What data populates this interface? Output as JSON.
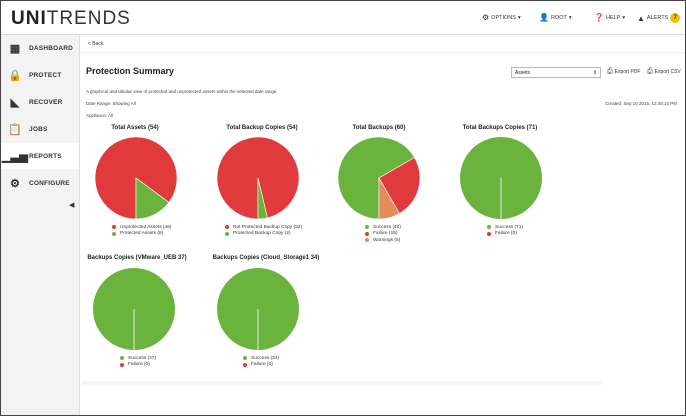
{
  "app": {
    "logo_bold": "UNI",
    "logo_rest": "TRENDS"
  },
  "topmenu": {
    "options": "OPTIONS",
    "root": "ROOT",
    "help": "HELP",
    "alerts": "ALERTS",
    "alerts_count": "7"
  },
  "sidebar": {
    "items": [
      {
        "label": "DASHBOARD",
        "icon": "grid-icon"
      },
      {
        "label": "PROTECT",
        "icon": "lock-icon"
      },
      {
        "label": "RECOVER",
        "icon": "recover-icon"
      },
      {
        "label": "JOBS",
        "icon": "clipboard-icon"
      },
      {
        "label": "REPORTS",
        "icon": "bar-chart-icon"
      },
      {
        "label": "CONFIGURE",
        "icon": "gear-icon"
      }
    ],
    "active": "REPORTS"
  },
  "page": {
    "back": "< Back",
    "title": "Protection Summary",
    "description": "A graphical and tabular view of protected and unprotected assets within the selected date range.",
    "date_range": "Date Range: Showing All",
    "appliance": "Appliance: All",
    "created": "Created: Sep 10 2015, 12:48:10 PM",
    "select_value": "Assets",
    "export_pdf": "Export PDF",
    "export_csv": "Export CSV"
  },
  "colors": {
    "red": "#e03a3c",
    "green": "#6ab43e",
    "orange": "#e58a5a"
  },
  "chart_data": [
    {
      "type": "pie",
      "title": "Total Assets (54)",
      "slices": [
        {
          "label": "Unprotected Assets (46)",
          "value": 46,
          "color": "#e03a3c"
        },
        {
          "label": "Protected Assets (8)",
          "value": 8,
          "color": "#6ab43e"
        }
      ]
    },
    {
      "type": "pie",
      "title": "Total Backup Copies (54)",
      "slices": [
        {
          "label": "Not Protected Backup Copy (52)",
          "value": 52,
          "color": "#e03a3c"
        },
        {
          "label": "Protected Backup Copy (2)",
          "value": 2,
          "color": "#6ab43e"
        }
      ]
    },
    {
      "type": "pie",
      "title": "Total Backups (60)",
      "slices": [
        {
          "label": "Success (40)",
          "value": 40,
          "color": "#6ab43e"
        },
        {
          "label": "Failure (15)",
          "value": 15,
          "color": "#e03a3c"
        },
        {
          "label": "Warnings (5)",
          "value": 5,
          "color": "#e58a5a"
        }
      ]
    },
    {
      "type": "pie",
      "title": "Total Backups Copies (71)",
      "slices": [
        {
          "label": "Success (71)",
          "value": 71,
          "color": "#6ab43e"
        },
        {
          "label": "Failure (0)",
          "value": 0,
          "color": "#e03a3c"
        }
      ]
    },
    {
      "type": "pie",
      "title": "Backups Copies (VMware_UEB 37)",
      "slices": [
        {
          "label": "Success (37)",
          "value": 37,
          "color": "#6ab43e"
        },
        {
          "label": "Failure (0)",
          "value": 0,
          "color": "#e03a3c"
        }
      ]
    },
    {
      "type": "pie",
      "title": "Backups Copies (Cloud_Storage1 34)",
      "slices": [
        {
          "label": "Success (34)",
          "value": 34,
          "color": "#6ab43e"
        },
        {
          "label": "Failure (0)",
          "value": 0,
          "color": "#e03a3c"
        }
      ]
    }
  ]
}
